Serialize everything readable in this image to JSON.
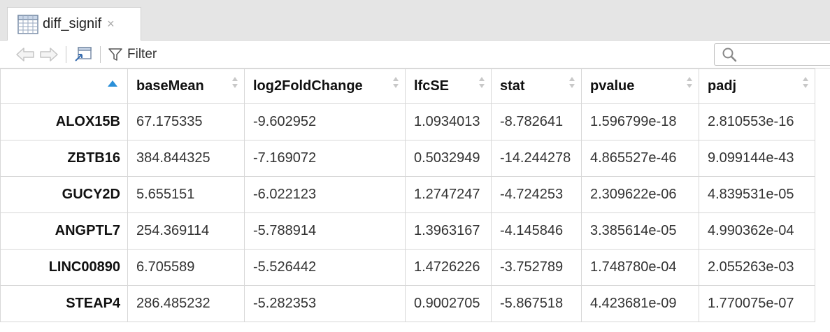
{
  "tab": {
    "label": "diff_signif",
    "close": "×"
  },
  "toolbar": {
    "filter_label": "Filter",
    "search_placeholder": ""
  },
  "table": {
    "columns": [
      "",
      "baseMean",
      "log2FoldChange",
      "lfcSE",
      "stat",
      "pvalue",
      "padj"
    ],
    "rows": [
      [
        "ALOX15B",
        "67.175335",
        "-9.602952",
        "1.0934013",
        "-8.782641",
        "1.596799e-18",
        "2.810553e-16"
      ],
      [
        "ZBTB16",
        "384.844325",
        "-7.169072",
        "0.5032949",
        "-14.244278",
        "4.865527e-46",
        "9.099144e-43"
      ],
      [
        "GUCY2D",
        "5.655151",
        "-6.022123",
        "1.2747247",
        "-4.724253",
        "2.309622e-06",
        "4.839531e-05"
      ],
      [
        "ANGPTL7",
        "254.369114",
        "-5.788914",
        "1.3963167",
        "-4.145846",
        "3.385614e-05",
        "4.990362e-04"
      ],
      [
        "LINC00890",
        "6.705589",
        "-5.526442",
        "1.4726226",
        "-3.752789",
        "1.748780e-04",
        "2.055263e-03"
      ],
      [
        "STEAP4",
        "286.485232",
        "-5.282353",
        "0.9002705",
        "-5.867518",
        "4.423681e-09",
        "1.770075e-07"
      ]
    ]
  },
  "colors": {
    "sort_active": "#2a8fd8",
    "sort_inactive": "#c8c8c8",
    "tab_bg": "#e5e5e5"
  }
}
